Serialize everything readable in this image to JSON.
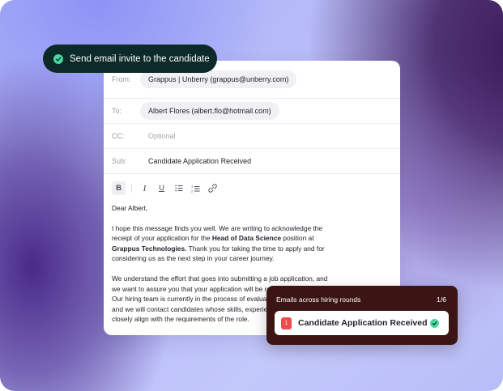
{
  "toast": {
    "text": "Send email invite to the candidate"
  },
  "email": {
    "from": {
      "label": "From:",
      "value": "Grappus | Unberry (grappus@unberry.com)"
    },
    "to": {
      "label": "To:",
      "value": "Albert Flores (albert.flo@hotmail.com)"
    },
    "cc": {
      "label": "CC:",
      "placeholder": "Optional"
    },
    "subject": {
      "label": "Sub:",
      "value": "Candidate Application Received"
    },
    "toolbar": {
      "bold": "B",
      "italic": "I",
      "underline": "U",
      "bullet_list": "bullet-list-icon",
      "numbered_list": "numbered-list-icon",
      "link": "link-icon"
    },
    "body": {
      "greeting": "Dear Albert,",
      "p1_a": "I hope this message finds you well. We are writing to acknowledge the receipt of your application for the ",
      "p1_role": "Head of Data Science",
      "p1_b": " position at ",
      "p1_company": "Grappus Technologies.",
      "p1_c": " Thank you for taking the time to apply and for considering us as the next step in your career journey.",
      "p2": "We understand the effort that goes into submitting a job application, and we want to assure you that your application will be reviewed thoroughly. Our hiring team is currently in the process of evaluating all applications, and we will contact candidates whose skills, experience, and aspirations closely align with the requirements of the role."
    }
  },
  "rounds": {
    "title": "Emails across hiring rounds",
    "counter": "1/6",
    "item": {
      "number": "1",
      "title": "Candidate Application Received"
    }
  },
  "colors": {
    "toast_bg": "#0c2a27",
    "success_green": "#4ad7a0",
    "rounds_bg": "#3b1513",
    "badge_red": "#ee4b4b"
  }
}
